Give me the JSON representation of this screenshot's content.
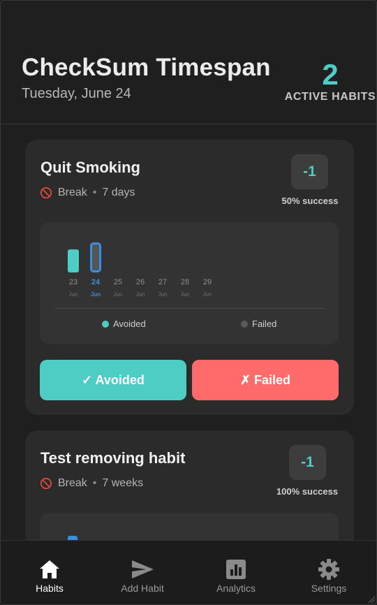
{
  "header": {
    "title": "CheckSum Timespan",
    "date": "Tuesday, June 24",
    "active_count": "2",
    "active_label": "ACTIVE HABITS"
  },
  "habits": [
    {
      "title": "Quit Smoking",
      "type": "Break",
      "duration": "7 days",
      "score": "-1",
      "success": "50% success",
      "days": [
        {
          "num": "23",
          "month": "Jun",
          "status": "avoided"
        },
        {
          "num": "24",
          "month": "Jun",
          "status": "today"
        },
        {
          "num": "25",
          "month": "Jun",
          "status": "none"
        },
        {
          "num": "26",
          "month": "Jun",
          "status": "none"
        },
        {
          "num": "27",
          "month": "Jun",
          "status": "none"
        },
        {
          "num": "28",
          "month": "Jun",
          "status": "none"
        },
        {
          "num": "29",
          "month": "Jun",
          "status": "none"
        }
      ],
      "legend": {
        "avoided": "Avoided",
        "failed": "Failed"
      },
      "buttons": {
        "avoided": "✓ Avoided",
        "failed": "✗ Failed"
      }
    },
    {
      "title": "Test removing habit",
      "type": "Break",
      "duration": "7 weeks",
      "score": "-1",
      "success": "100% success"
    }
  ],
  "colors": {
    "accent": "#4ecdc4",
    "failed": "#ff6b6b",
    "today": "#3b8fe0",
    "failed_dot": "#5a5a5a"
  },
  "nav": [
    {
      "label": "Habits",
      "icon": "home-icon",
      "active": true
    },
    {
      "label": "Add Habit",
      "icon": "send-icon",
      "active": false
    },
    {
      "label": "Analytics",
      "icon": "analytics-icon",
      "active": false
    },
    {
      "label": "Settings",
      "icon": "gear-icon",
      "active": false
    }
  ]
}
